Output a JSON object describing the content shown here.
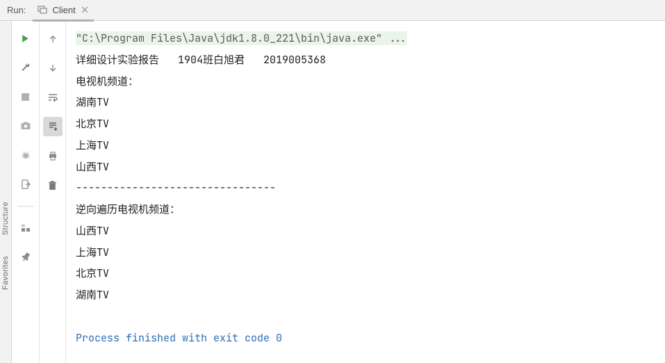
{
  "header": {
    "run_label": "Run:",
    "tab_title": "Client"
  },
  "sidebar": {
    "items": [
      "Structure",
      "Favorites"
    ]
  },
  "console": {
    "cmd_line": "\"C:\\Program Files\\Java\\jdk1.8.0_221\\bin\\java.exe\" ...",
    "lines": [
      "详细设计实验报告   1904班白旭君   2019005368",
      "电视机频道：",
      "湖南TV",
      "北京TV",
      "上海TV",
      "山西TV",
      "--------------------------------",
      "逆向遍历电视机频道：",
      "山西TV",
      "上海TV",
      "北京TV",
      "湖南TV",
      ""
    ],
    "exit_line": "Process finished with exit code 0"
  }
}
